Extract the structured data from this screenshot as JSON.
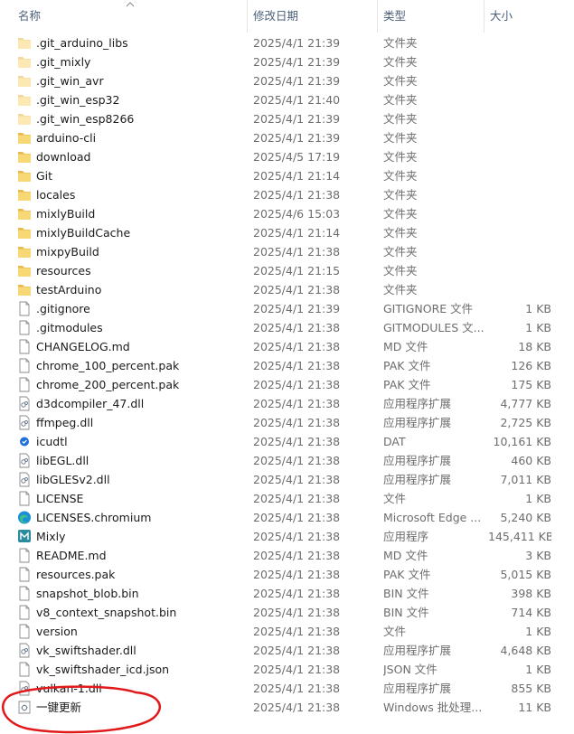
{
  "header": {
    "name": "名称",
    "date": "修改日期",
    "type": "类型",
    "size": "大小"
  },
  "rows": [
    {
      "name": ".git_arduino_libs",
      "date": "2025/4/1 21:39",
      "type": "文件夹",
      "size": "",
      "icon": "folder-faded-icon"
    },
    {
      "name": ".git_mixly",
      "date": "2025/4/1 21:39",
      "type": "文件夹",
      "size": "",
      "icon": "folder-faded-icon"
    },
    {
      "name": ".git_win_avr",
      "date": "2025/4/1 21:39",
      "type": "文件夹",
      "size": "",
      "icon": "folder-faded-icon"
    },
    {
      "name": ".git_win_esp32",
      "date": "2025/4/1 21:40",
      "type": "文件夹",
      "size": "",
      "icon": "folder-faded-icon"
    },
    {
      "name": ".git_win_esp8266",
      "date": "2025/4/1 21:39",
      "type": "文件夹",
      "size": "",
      "icon": "folder-faded-icon"
    },
    {
      "name": "arduino-cli",
      "date": "2025/4/1 21:39",
      "type": "文件夹",
      "size": "",
      "icon": "folder-icon"
    },
    {
      "name": "download",
      "date": "2025/4/5 17:19",
      "type": "文件夹",
      "size": "",
      "icon": "folder-icon"
    },
    {
      "name": "Git",
      "date": "2025/4/1 21:14",
      "type": "文件夹",
      "size": "",
      "icon": "folder-icon"
    },
    {
      "name": "locales",
      "date": "2025/4/1 21:38",
      "type": "文件夹",
      "size": "",
      "icon": "folder-icon"
    },
    {
      "name": "mixlyBuild",
      "date": "2025/4/6 15:03",
      "type": "文件夹",
      "size": "",
      "icon": "folder-icon"
    },
    {
      "name": "mixlyBuildCache",
      "date": "2025/4/1 21:14",
      "type": "文件夹",
      "size": "",
      "icon": "folder-icon"
    },
    {
      "name": "mixpyBuild",
      "date": "2025/4/1 21:38",
      "type": "文件夹",
      "size": "",
      "icon": "folder-icon"
    },
    {
      "name": "resources",
      "date": "2025/4/1 21:15",
      "type": "文件夹",
      "size": "",
      "icon": "folder-icon"
    },
    {
      "name": "testArduino",
      "date": "2025/4/1 21:38",
      "type": "文件夹",
      "size": "",
      "icon": "folder-icon"
    },
    {
      "name": ".gitignore",
      "date": "2025/4/1 21:39",
      "type": "GITIGNORE 文件",
      "size": "1 KB",
      "icon": "file-icon"
    },
    {
      "name": ".gitmodules",
      "date": "2025/4/1 21:38",
      "type": "GITMODULES 文...",
      "size": "1 KB",
      "icon": "file-icon"
    },
    {
      "name": "CHANGELOG.md",
      "date": "2025/4/1 21:38",
      "type": "MD 文件",
      "size": "18 KB",
      "icon": "file-icon"
    },
    {
      "name": "chrome_100_percent.pak",
      "date": "2025/4/1 21:38",
      "type": "PAK 文件",
      "size": "126 KB",
      "icon": "file-icon"
    },
    {
      "name": "chrome_200_percent.pak",
      "date": "2025/4/1 21:38",
      "type": "PAK 文件",
      "size": "175 KB",
      "icon": "file-icon"
    },
    {
      "name": "d3dcompiler_47.dll",
      "date": "2025/4/1 21:38",
      "type": "应用程序扩展",
      "size": "4,777 KB",
      "icon": "dll-icon"
    },
    {
      "name": "ffmpeg.dll",
      "date": "2025/4/1 21:38",
      "type": "应用程序扩展",
      "size": "2,725 KB",
      "icon": "dll-icon"
    },
    {
      "name": "icudtl",
      "date": "2025/4/1 21:38",
      "type": "DAT",
      "size": "10,161 KB",
      "icon": "dat-icon"
    },
    {
      "name": "libEGL.dll",
      "date": "2025/4/1 21:38",
      "type": "应用程序扩展",
      "size": "460 KB",
      "icon": "dll-icon"
    },
    {
      "name": "libGLESv2.dll",
      "date": "2025/4/1 21:38",
      "type": "应用程序扩展",
      "size": "7,011 KB",
      "icon": "dll-icon"
    },
    {
      "name": "LICENSE",
      "date": "2025/4/1 21:38",
      "type": "文件",
      "size": "1 KB",
      "icon": "file-icon"
    },
    {
      "name": "LICENSES.chromium",
      "date": "2025/4/1 21:38",
      "type": "Microsoft Edge ...",
      "size": "5,240 KB",
      "icon": "edge-icon"
    },
    {
      "name": "Mixly",
      "date": "2025/4/1 21:38",
      "type": "应用程序",
      "size": "145,411 KB",
      "icon": "mixly-app-icon"
    },
    {
      "name": "README.md",
      "date": "2025/4/1 21:38",
      "type": "MD 文件",
      "size": "3 KB",
      "icon": "file-icon"
    },
    {
      "name": "resources.pak",
      "date": "2025/4/1 21:38",
      "type": "PAK 文件",
      "size": "5,015 KB",
      "icon": "file-icon"
    },
    {
      "name": "snapshot_blob.bin",
      "date": "2025/4/1 21:38",
      "type": "BIN 文件",
      "size": "398 KB",
      "icon": "file-icon"
    },
    {
      "name": "v8_context_snapshot.bin",
      "date": "2025/4/1 21:38",
      "type": "BIN 文件",
      "size": "714 KB",
      "icon": "file-icon"
    },
    {
      "name": "version",
      "date": "2025/4/1 21:38",
      "type": "文件",
      "size": "1 KB",
      "icon": "file-icon"
    },
    {
      "name": "vk_swiftshader.dll",
      "date": "2025/4/1 21:38",
      "type": "应用程序扩展",
      "size": "4,648 KB",
      "icon": "dll-icon"
    },
    {
      "name": "vk_swiftshader_icd.json",
      "date": "2025/4/1 21:38",
      "type": "JSON 文件",
      "size": "1 KB",
      "icon": "file-icon"
    },
    {
      "name": "vulkan-1.dll",
      "date": "2025/4/1 21:38",
      "type": "应用程序扩展",
      "size": "855 KB",
      "icon": "dll-icon"
    },
    {
      "name": "一键更新",
      "date": "2025/4/1 21:38",
      "type": "Windows 批处理...",
      "size": "11 KB",
      "icon": "batch-file-icon"
    }
  ],
  "colors": {
    "folder": "#f8d775",
    "folder_dark": "#e8b84a",
    "annotation": "#e0191b",
    "header_text": "#4c607a"
  }
}
